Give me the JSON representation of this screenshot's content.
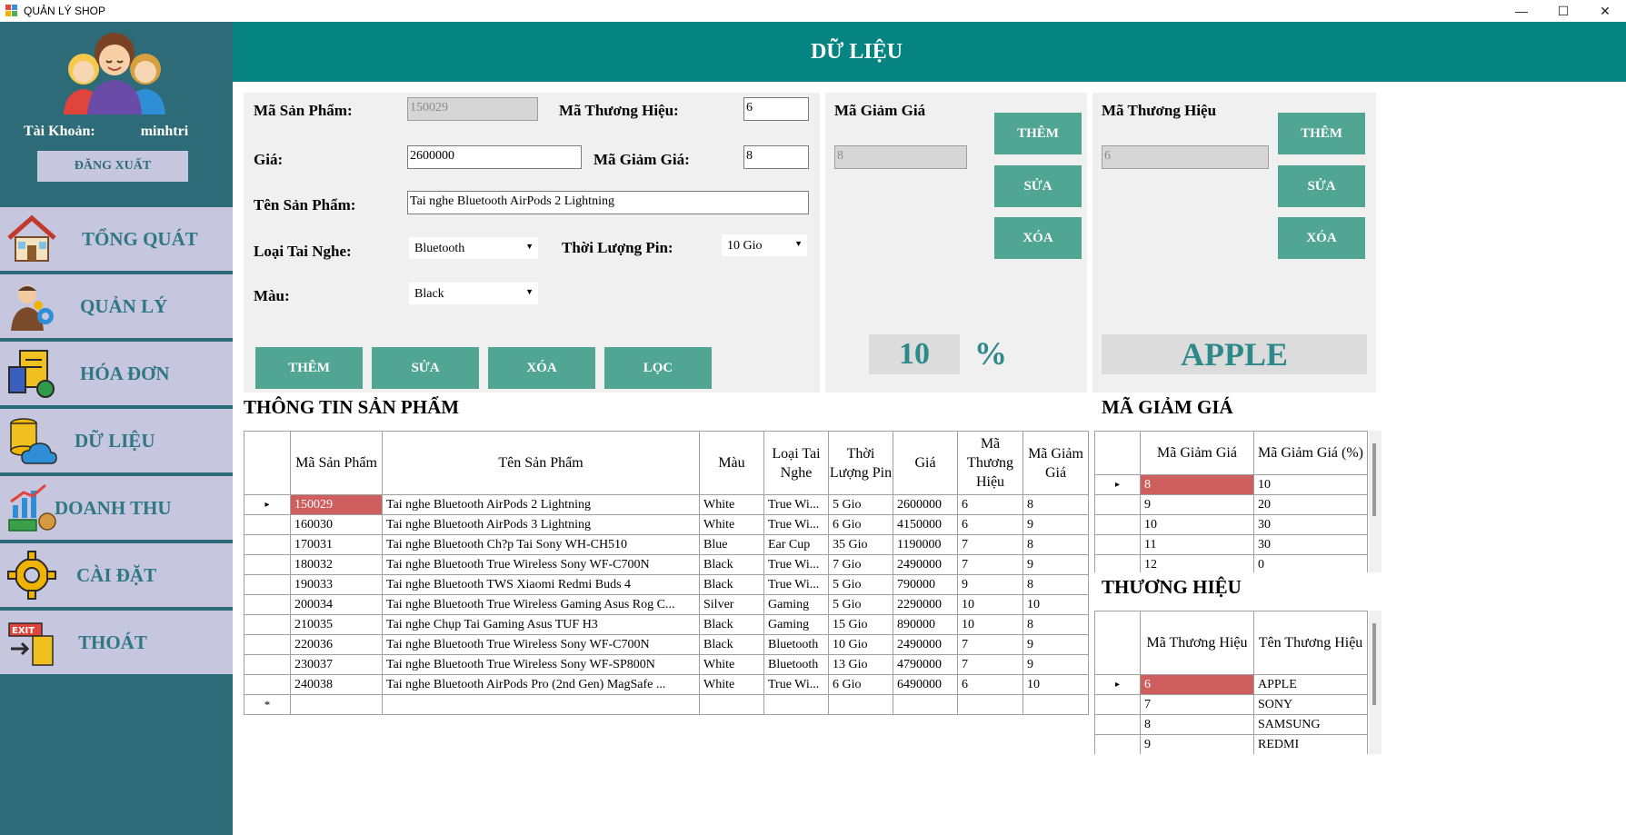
{
  "window": {
    "title": "QUẢN LÝ SHOP",
    "minimize": "—",
    "maximize": "☐",
    "close": "✕"
  },
  "sidebar": {
    "account_label": "Tài Khoản:",
    "account_value": "minhtri",
    "logout_label": "ĐĂNG XUẤT",
    "items": [
      {
        "label": "TỔNG QUÁT",
        "icon": "house-icon"
      },
      {
        "label": "QUẢN LÝ",
        "icon": "manager-icon"
      },
      {
        "label": "HÓA ĐƠN",
        "icon": "invoice-icon"
      },
      {
        "label": "DỮ LIỆU",
        "icon": "database-cloud-icon"
      },
      {
        "label": "DOANH THU",
        "icon": "revenue-chart-icon"
      },
      {
        "label": "CÀI ĐẶT",
        "icon": "gear-icon"
      },
      {
        "label": "THOÁT",
        "icon": "exit-icon"
      }
    ]
  },
  "header": {
    "title": "DỮ LIỆU"
  },
  "product_form": {
    "ma_san_pham_label": "Mã Sản Phẩm:",
    "ma_san_pham_value": "150029",
    "ma_thuong_hieu_label": "Mã Thương Hiệu:",
    "ma_thuong_hieu_value": "6",
    "gia_label": "Giá:",
    "gia_value": "2600000",
    "ma_giam_gia_label": "Mã Giảm Giá:",
    "ma_giam_gia_value": "8",
    "ten_san_pham_label": "Tên Sản Phẩm:",
    "ten_san_pham_value": "Tai nghe Bluetooth AirPods 2 Lightning",
    "loai_tai_nghe_label": "Loại Tai Nghe:",
    "loai_tai_nghe_value": "Bluetooth",
    "thoi_luong_pin_label": "Thời Lượng Pin:",
    "thoi_luong_pin_value": "10 Gio",
    "mau_label": "Màu:",
    "mau_value": "Black",
    "btn_them": "THÊM",
    "btn_sua": "SỬA",
    "btn_xoa": "XÓA",
    "btn_loc": "LỌC"
  },
  "discount_form": {
    "label": "Mã Giảm Giá",
    "value": "8",
    "btn_them": "THÊM",
    "btn_sua": "SỬA",
    "btn_xoa": "XÓA",
    "percent_value": "10",
    "percent_sign": "%"
  },
  "brand_form": {
    "label": "Mã Thương Hiệu",
    "value": "6",
    "btn_them": "THÊM",
    "btn_sua": "SỬA",
    "btn_xoa": "XÓA",
    "brand_name": "APPLE"
  },
  "products": {
    "title": "THÔNG TIN SẢN PHẨM",
    "columns": [
      "Mã Sản Phẩm",
      "Tên Sản Phẩm",
      "Màu",
      "Loại Tai Nghe",
      "Thời Lượng Pin",
      "Giá",
      "Mã Thương Hiệu",
      "Mã Giảm Giá"
    ],
    "rows": [
      [
        "150029",
        "Tai nghe Bluetooth AirPods 2 Lightning",
        "White",
        "True Wi...",
        "5 Gio",
        "2600000",
        "6",
        "8"
      ],
      [
        "160030",
        "Tai nghe Bluetooth AirPods 3 Lightning",
        "White",
        "True Wi...",
        "6 Gio",
        "4150000",
        "6",
        "9"
      ],
      [
        "170031",
        "Tai nghe Bluetooth Ch?p Tai Sony WH-CH510",
        "Blue",
        "Ear Cup",
        "35 Gio",
        "1190000",
        "7",
        "8"
      ],
      [
        "180032",
        "Tai nghe Bluetooth True Wireless Sony WF-C700N",
        "Black",
        "True Wi...",
        "7 Gio",
        "2490000",
        "7",
        "9"
      ],
      [
        "190033",
        "Tai nghe Bluetooth TWS Xiaomi Redmi Buds 4",
        "Black",
        "True Wi...",
        "5 Gio",
        "790000",
        "9",
        "8"
      ],
      [
        "200034",
        "Tai nghe Bluetooth True Wireless Gaming Asus Rog C...",
        "Silver",
        "Gaming",
        "5 Gio",
        "2290000",
        "10",
        "10"
      ],
      [
        "210035",
        "Tai nghe Chụp Tai Gaming Asus TUF H3",
        "Black",
        "Gaming",
        "15 Gio",
        "890000",
        "10",
        "8"
      ],
      [
        "220036",
        "Tai nghe Bluetooth True Wireless Sony WF-C700N",
        "Black",
        "Bluetooth",
        "10 Gio",
        "2490000",
        "7",
        "9"
      ],
      [
        "230037",
        "Tai nghe Bluetooth True Wireless Sony WF-SP800N",
        "White",
        "Bluetooth",
        "13 Gio",
        "4790000",
        "7",
        "9"
      ],
      [
        "240038",
        "Tai nghe Bluetooth AirPods Pro (2nd Gen) MagSafe ...",
        "White",
        "True Wi...",
        "6 Gio",
        "6490000",
        "6",
        "10"
      ]
    ],
    "new_row_marker": "*",
    "current_row_marker": "▸"
  },
  "discounts": {
    "title": "MÃ GIẢM GIÁ",
    "columns": [
      "Mã Giảm Giá",
      "Mã Giảm Giá (%)"
    ],
    "rows": [
      [
        "8",
        "10"
      ],
      [
        "9",
        "20"
      ],
      [
        "10",
        "30"
      ],
      [
        "11",
        "30"
      ],
      [
        "12",
        "0"
      ]
    ]
  },
  "brands": {
    "title": "THƯƠNG HIỆU",
    "columns": [
      "Mã Thương Hiệu",
      "Tên Thương Hiệu"
    ],
    "rows": [
      [
        "6",
        "APPLE"
      ],
      [
        "7",
        "SONY"
      ],
      [
        "8",
        "SAMSUNG"
      ],
      [
        "9",
        "REDMI"
      ]
    ]
  }
}
